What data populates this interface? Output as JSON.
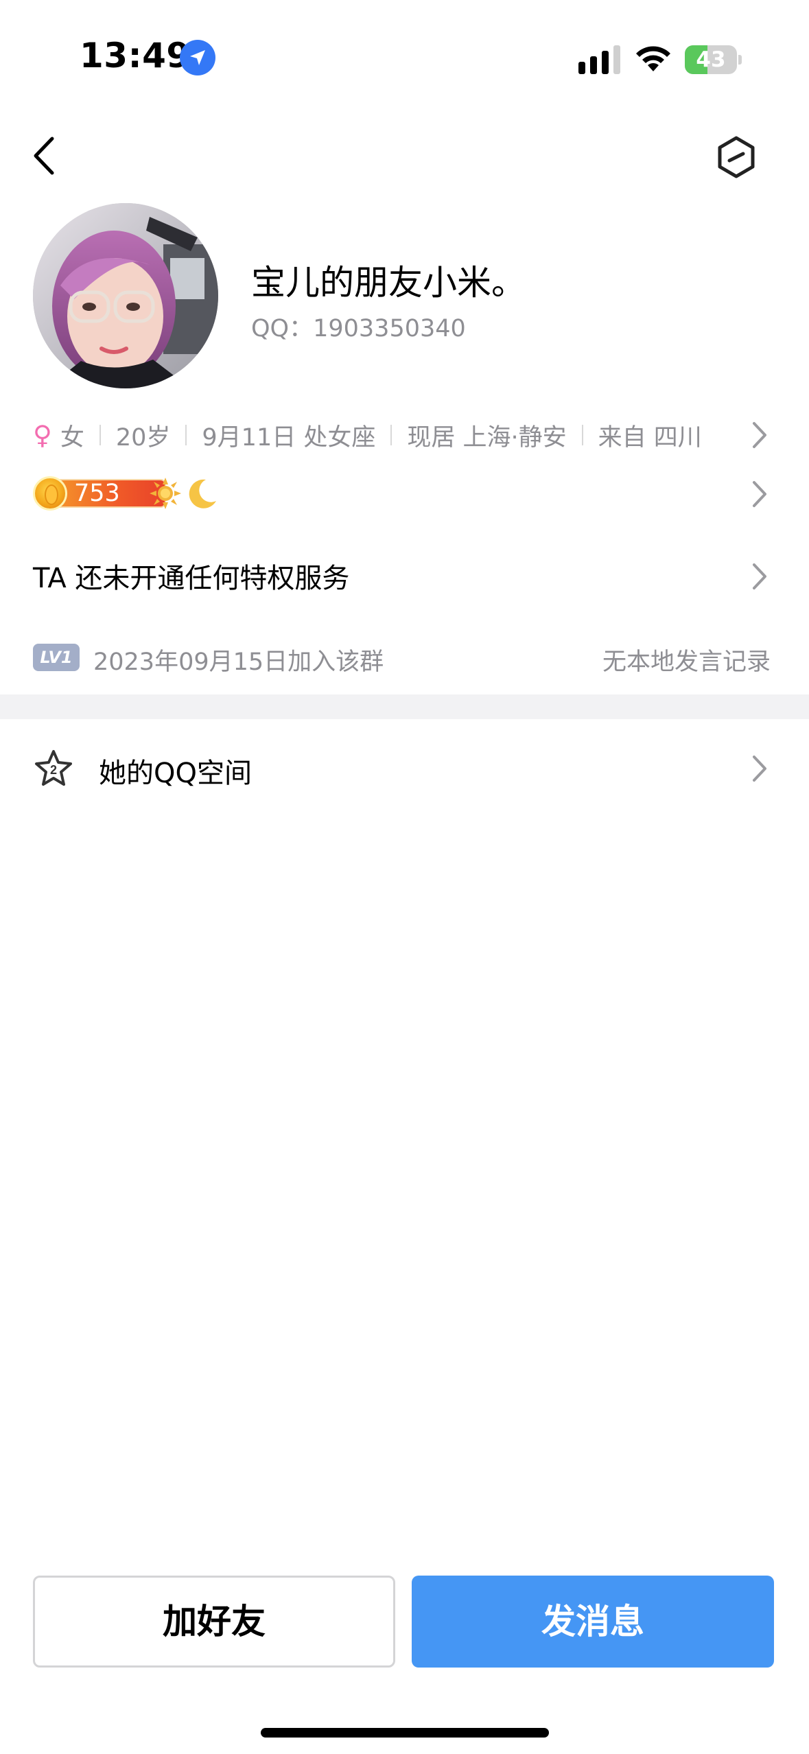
{
  "status_bar": {
    "time": "13:49",
    "battery_level": "43",
    "battery_fraction": 0.43,
    "icons": [
      "location-arrow-icon",
      "cellular-signal-icon",
      "wifi-icon",
      "battery-charging-icon"
    ]
  },
  "nav": {
    "back_icon": "chevron-left-icon",
    "settings_icon": "hexagon-minus-icon"
  },
  "profile": {
    "nickname": "宝儿的朋友小米。",
    "qq_number": "QQ：1903350340"
  },
  "info": {
    "gender_symbol": "♀",
    "gender": "女",
    "age": "20岁",
    "birthday": "9月11日 处女座",
    "residence": "现居 上海·静安",
    "hometown": "来自 四川"
  },
  "level": {
    "coin_value": "753",
    "icons": [
      "sun-badge-icon",
      "moon-badge-icon"
    ]
  },
  "privilege": {
    "text": "TA 还未开通任何特权服务"
  },
  "group": {
    "level_badge": "LV1",
    "join_date": "2023年09月15日加入该群",
    "message_record": "无本地发言记录"
  },
  "qzone": {
    "icon": "star-2-icon",
    "label": "她的QQ空间"
  },
  "actions": {
    "add_friend": "加好友",
    "send_message": "发消息"
  },
  "colors": {
    "primary": "#4596f4",
    "secondary_text": "#8e8e93",
    "gender": "#f36db0",
    "battery": "#5ac85c"
  }
}
